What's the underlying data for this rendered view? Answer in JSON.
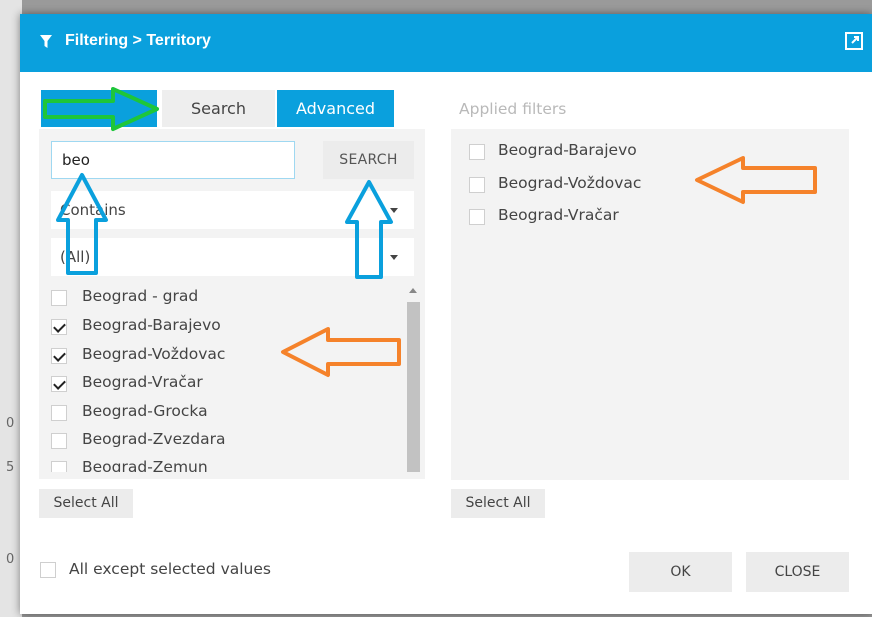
{
  "title": "Filtering > Territory",
  "tabs": {
    "search_label": "Search",
    "advanced_label": "Advanced"
  },
  "search": {
    "value": "beo",
    "button_label": "SEARCH"
  },
  "selects": {
    "operator_value": "Contains",
    "scope_value": "(All)"
  },
  "list_items": [
    {
      "label": "Beograd - grad",
      "checked": false
    },
    {
      "label": "Beograd-Barajevo",
      "checked": true
    },
    {
      "label": "Beograd-Voždovac",
      "checked": true
    },
    {
      "label": "Beograd-Vračar",
      "checked": true
    },
    {
      "label": "Beograd-Grocka",
      "checked": false
    },
    {
      "label": "Beograd-Zvezdara",
      "checked": false
    },
    {
      "label": "Beograd-Zemun",
      "checked": false
    }
  ],
  "applied": {
    "title": "Applied filters",
    "items": [
      {
        "label": "Beograd-Barajevo",
        "checked": false
      },
      {
        "label": "Beograd-Voždovac",
        "checked": false
      },
      {
        "label": "Beograd-Vračar",
        "checked": false
      }
    ]
  },
  "select_all_label": "Select All",
  "except_label": "All except selected values",
  "buttons": {
    "ok_label": "OK",
    "close_label": "CLOSE"
  },
  "background_glyphs": [
    "0",
    "5",
    "0"
  ],
  "icons": {
    "title": "filter-icon",
    "expand": "expand-icon"
  },
  "colors": {
    "accent": "#0aa0dd",
    "annotation_green": "#1ec63a",
    "annotation_blue": "#0aa0dd",
    "annotation_orange": "#f5822a"
  }
}
